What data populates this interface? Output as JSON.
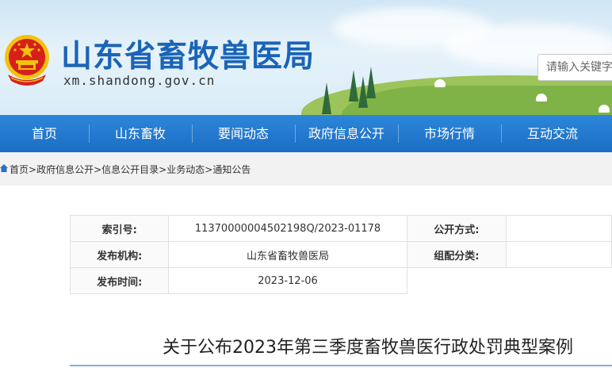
{
  "header": {
    "site_title": "山东省畜牧兽医局",
    "site_domain": "xm.shandong.gov.cn",
    "search_placeholder": "请输入关键字"
  },
  "nav": {
    "items": [
      "首页",
      "山东畜牧",
      "要闻动态",
      "政府信息公开",
      "市场行情",
      "互动交流"
    ]
  },
  "breadcrumb": {
    "items": [
      "首页",
      "政府信息公开",
      "信息公开目录",
      "业务动态",
      "通知公告"
    ],
    "separator": ">"
  },
  "info_table": {
    "index_label": "索引号:",
    "index_value": "11370000004502198Q/2023-01178",
    "publish_method_label": "公开方式:",
    "publisher_label": "发布机构:",
    "publisher_value": "山东省畜牧兽医局",
    "category_label": "组配分类:",
    "date_label": "发布时间:",
    "date_value": "2023-12-06"
  },
  "article": {
    "title": "关于公布2023年第三季度畜牧兽医行政处罚典型案例"
  },
  "colors": {
    "brand_blue": "#1b6ec4",
    "title_blue": "#1a64b8",
    "emblem_red": "#d7201c",
    "emblem_gold": "#f4c20d"
  }
}
